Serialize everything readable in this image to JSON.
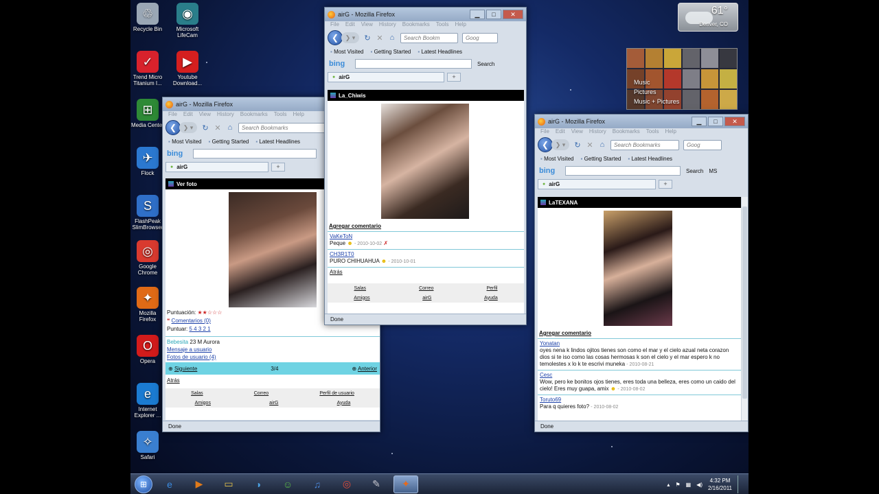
{
  "desktop": {
    "icons": [
      {
        "label": "Recycle Bin",
        "icon": "recycle-bin-icon",
        "color": "#9aa7b5"
      },
      {
        "label": "Microsoft LifeCam",
        "icon": "webcam-icon",
        "color": "#2a7e8a"
      },
      {
        "label": "Trend Micro Titanium I...",
        "icon": "trend-micro-icon",
        "color": "#d8222c"
      },
      {
        "label": "Youtube Download...",
        "icon": "youtube-icon",
        "color": "#d41f1f"
      },
      {
        "label": "Media Center",
        "icon": "windows-logo-icon",
        "color": "#2e8a36"
      },
      {
        "label": "Flock",
        "icon": "flock-icon",
        "color": "#2b78d0"
      },
      {
        "label": "FlashPeak SlimBrowser",
        "icon": "slimbrowser-icon",
        "color": "#2f6fc8"
      },
      {
        "label": "Google Chrome",
        "icon": "chrome-icon",
        "color": "#d93a2f"
      },
      {
        "label": "Mozilla Firefox",
        "icon": "firefox-icon",
        "color": "#e06a16"
      },
      {
        "label": "Opera",
        "icon": "opera-icon",
        "color": "#d21b1b"
      },
      {
        "label": "Internet Explorer ...",
        "icon": "ie-icon",
        "color": "#1b7bd2"
      },
      {
        "label": "Safari",
        "icon": "safari-icon",
        "color": "#3a7fd0"
      }
    ]
  },
  "weather": {
    "temp": "61°",
    "city": "Denver, CO"
  },
  "media_gadget": {
    "items": [
      "Music",
      "Pictures",
      "Music + Pictures"
    ]
  },
  "browser": {
    "menu": [
      "File",
      "Edit",
      "View",
      "History",
      "Bookmarks",
      "Tools",
      "Help"
    ],
    "search_placeholder": "Search Bookmarks",
    "search_placeholder_short": "Search Bookm",
    "google_label": "Goog",
    "bookmarks": [
      "Most Visited",
      "Getting Started",
      "Latest Headlines"
    ],
    "bing_label": "bing",
    "bing_search": "Search",
    "bing_ms": "MS",
    "tab_label": "airG",
    "new_tab": "+",
    "status": "Done"
  },
  "win_left": {
    "title": "airG - Mozilla Firefox",
    "header": "Ver foto",
    "rating_label": "Puntuación:",
    "rating_stars": "★★☆☆☆",
    "comments_link": "Comentarios (0)",
    "rate_label": "Puntuar:",
    "rate_values": "5 4 3 2 1",
    "user_name": "Bebesita",
    "user_info": "23 M Aurora",
    "message_link": "Mensaje a usuario",
    "photos_link": "Fotos de usuario (4)",
    "next_link": "Siguiente",
    "counter": "3/4",
    "prev_link": "Anterior",
    "back_link": "Atrás",
    "footer_row1": [
      "Salas",
      "Correo",
      "Perfil de usuario"
    ],
    "footer_row2": [
      "Amigos",
      "airG",
      "Ayuda"
    ]
  },
  "win_mid": {
    "title": "airG - Mozilla Firefox",
    "header": "La_Chiwis",
    "add_comment": "Agregar comentario",
    "comments": [
      {
        "user": "VaKeToN",
        "text": "Peque",
        "date": "- 2010-10-02"
      },
      {
        "user": "CH3R1T0",
        "text": "PURO CHIHUAHUA",
        "date": "- 2010-10-01"
      }
    ],
    "back_link": "Atrás",
    "footer_row1": [
      "Salas",
      "Correo",
      "Perfil"
    ],
    "footer_row2": [
      "Amigos",
      "airG",
      "Ayuda"
    ]
  },
  "win_right": {
    "title": "airG - Mozilla Firefox",
    "header": "LaTEXANA",
    "add_comment": "Agregar comentario",
    "comments": [
      {
        "user": "Yonatan",
        "text": "oyes nena k lindos ojitos tienes son como el mar y el cielo azual neta corazon dios si te iso como las cosas hermosas k son el cielo y el mar espero k no temolestes x lo k te escrivi muneka",
        "date": "- 2010-08-21"
      },
      {
        "user": "Cesc",
        "text": "Wow, pero ke bonitos ojos tienes, eres toda una belleza, eres como un caido del cielo! Eres muy guapa, amix",
        "date": "- 2010-08-02"
      },
      {
        "user": "Toruto69",
        "text": "Para q quieres foto?",
        "date": "- 2010-08-02"
      }
    ]
  },
  "taskbar": {
    "apps": [
      "ie-icon",
      "media-player-icon",
      "explorer-icon",
      "messenger-icon",
      "people-icon",
      "itunes-icon",
      "chrome-icon",
      "paint-icon",
      "firefox-icon"
    ],
    "time": "4:32 PM",
    "date": "2/16/2011"
  }
}
